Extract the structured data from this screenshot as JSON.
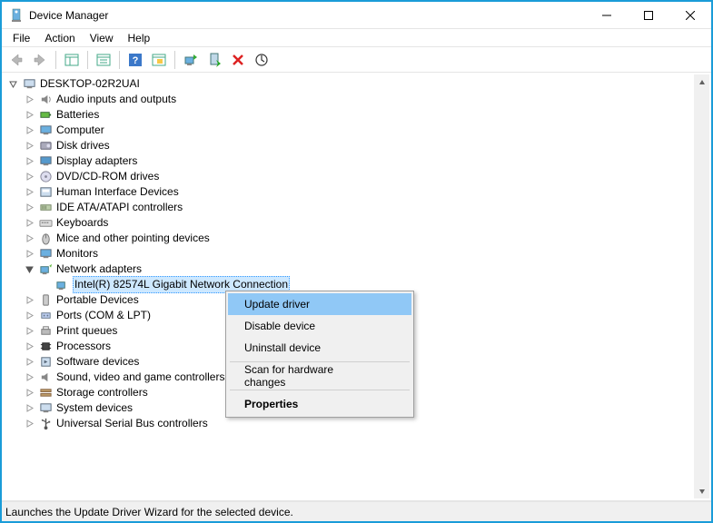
{
  "window": {
    "title": "Device Manager"
  },
  "menu": {
    "file": "File",
    "action": "Action",
    "view": "View",
    "help": "Help"
  },
  "tree": {
    "root": "DESKTOP-02R2UAI",
    "categories": [
      "Audio inputs and outputs",
      "Batteries",
      "Computer",
      "Disk drives",
      "Display adapters",
      "DVD/CD-ROM drives",
      "Human Interface Devices",
      "IDE ATA/ATAPI controllers",
      "Keyboards",
      "Mice and other pointing devices",
      "Monitors",
      "Network adapters",
      "Portable Devices",
      "Ports (COM & LPT)",
      "Print queues",
      "Processors",
      "Software devices",
      "Sound, video and game controllers",
      "Storage controllers",
      "System devices",
      "Universal Serial Bus controllers"
    ],
    "network_child": "Intel(R) 82574L Gigabit Network Connection"
  },
  "context_menu": {
    "update": "Update driver",
    "disable": "Disable device",
    "uninstall": "Uninstall device",
    "scan": "Scan for hardware changes",
    "properties": "Properties"
  },
  "status": "Launches the Update Driver Wizard for the selected device."
}
